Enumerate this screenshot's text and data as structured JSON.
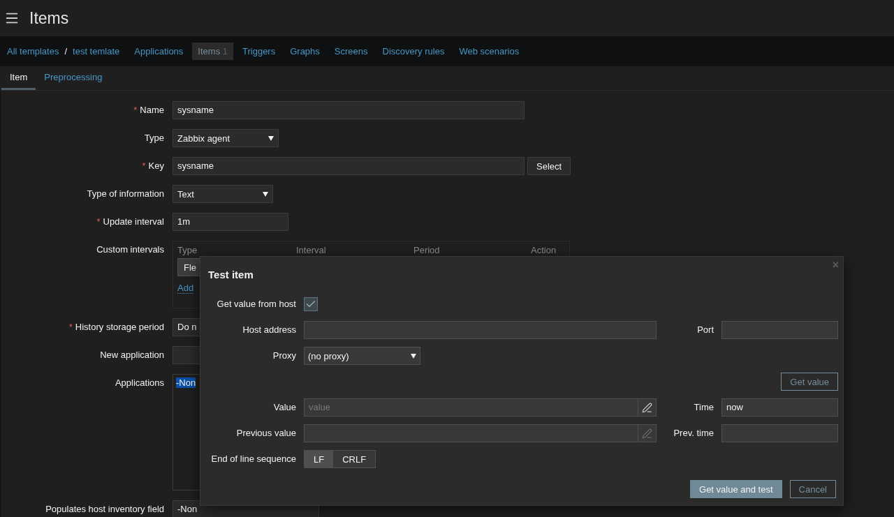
{
  "header": {
    "title": "Items"
  },
  "nav": {
    "breadcrumbs": [
      {
        "text": "All templates"
      },
      {
        "text": "test temlate"
      }
    ],
    "separator": "/",
    "items": [
      {
        "label": "Applications",
        "selected": false
      },
      {
        "label": "Items",
        "count": "1",
        "selected": true
      },
      {
        "label": "Triggers",
        "selected": false
      },
      {
        "label": "Graphs",
        "selected": false
      },
      {
        "label": "Screens",
        "selected": false
      },
      {
        "label": "Discovery rules",
        "selected": false
      },
      {
        "label": "Web scenarios",
        "selected": false
      }
    ]
  },
  "tabs": [
    {
      "label": "Item",
      "selected": true
    },
    {
      "label": "Preprocessing",
      "selected": false
    }
  ],
  "form": {
    "rows": [
      {
        "kind": "text",
        "label": "Name",
        "required_mark": "*",
        "value": "sysname"
      },
      {
        "kind": "select",
        "label": "Type",
        "value": "Zabbix agent"
      },
      {
        "kind": "text-button",
        "label": "Key",
        "required_mark": "*",
        "value": "sysname",
        "button": "Select"
      },
      {
        "kind": "select",
        "label": "Type of information",
        "value": "Text"
      },
      {
        "kind": "text",
        "label": "Update interval",
        "required_mark": "*",
        "value": "1m"
      },
      {
        "kind": "intervals",
        "label": "Custom intervals",
        "columns": [
          "Type",
          "Interval",
          "Period",
          "Action"
        ],
        "type_button": "Fle",
        "add_link": "Add"
      },
      {
        "kind": "text",
        "label": "History storage period",
        "required_mark": "*",
        "value": "Do n"
      },
      {
        "kind": "text",
        "label": "New application"
      },
      {
        "kind": "listbox",
        "label": "Applications",
        "items": [
          {
            "text": "-Non",
            "selected": true
          }
        ]
      },
      {
        "kind": "text",
        "label": "Populates host inventory field",
        "value": "-Non"
      }
    ]
  },
  "dialog": {
    "title": "Test item",
    "close": "×",
    "get_value_from_host": {
      "label": "Get value from host",
      "checked": true
    },
    "host_address": {
      "label": "Host address"
    },
    "port": {
      "label": "Port"
    },
    "proxy": {
      "label": "Proxy",
      "value": "(no proxy)"
    },
    "get_value_button": "Get value",
    "value": {
      "label": "Value",
      "placeholder": "value"
    },
    "time": {
      "label": "Time",
      "value": "now"
    },
    "previous_value": {
      "label": "Previous value"
    },
    "prev_time": {
      "label": "Prev. time"
    },
    "eol": {
      "label": "End of line sequence",
      "options": [
        {
          "label": "LF",
          "selected": true
        },
        {
          "label": "CRLF",
          "selected": false
        }
      ]
    },
    "buttons": [
      {
        "kind": "primary",
        "label": "Get value and test"
      },
      {
        "kind": "secondary",
        "label": "Cancel"
      }
    ]
  }
}
